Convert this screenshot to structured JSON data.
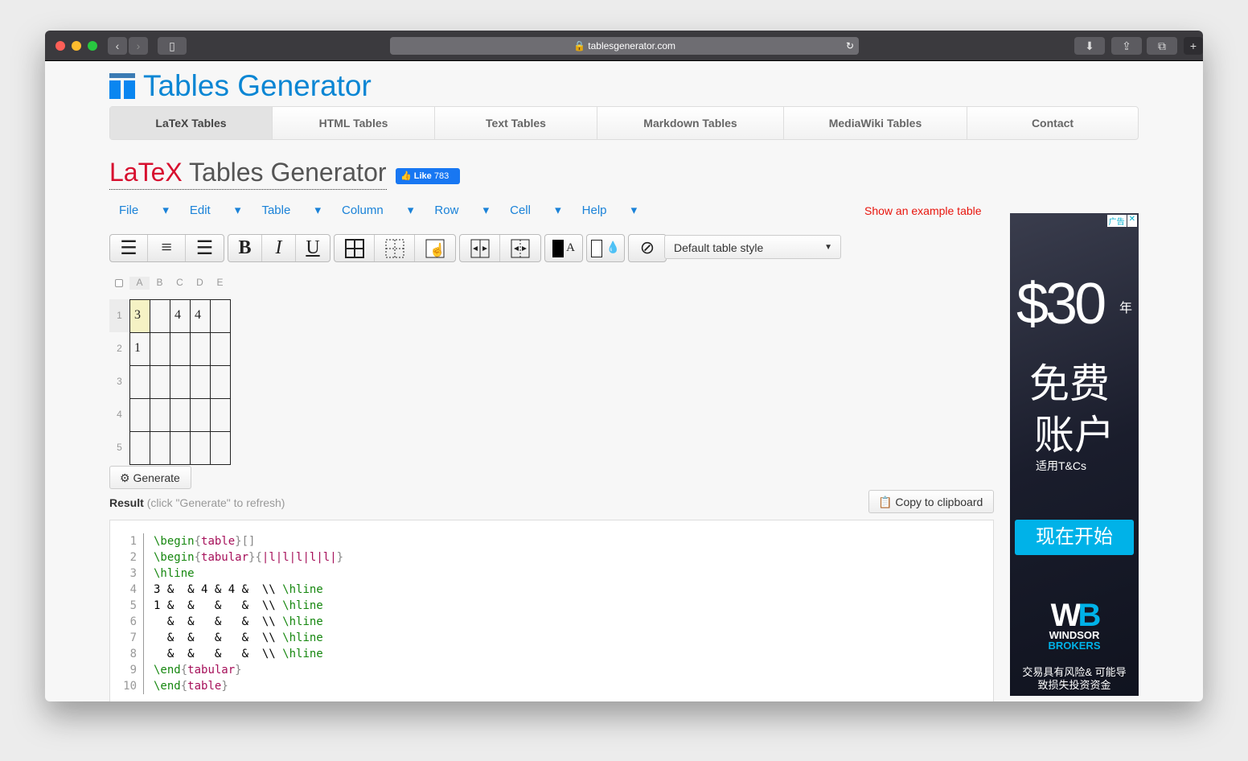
{
  "browser": {
    "url": "tablesgenerator.com"
  },
  "site": {
    "logo_text": "Tables Generator"
  },
  "nav": [
    {
      "label": "LaTeX Tables",
      "active": true
    },
    {
      "label": "HTML Tables"
    },
    {
      "label": "Text Tables"
    },
    {
      "label": "Markdown Tables"
    },
    {
      "label": "MediaWiki Tables"
    },
    {
      "label": "Contact"
    }
  ],
  "heading": {
    "latex": "LaTeX",
    "rest": " Tables Generator"
  },
  "like": {
    "label": "Like",
    "count": "783"
  },
  "menu": [
    "File",
    "Edit",
    "Table",
    "Column",
    "Row",
    "Cell",
    "Help"
  ],
  "example_link": "Show an example table",
  "table_style": "Default table style",
  "grid": {
    "columns": [
      "A",
      "B",
      "C",
      "D",
      "E"
    ],
    "rows": [
      "1",
      "2",
      "3",
      "4",
      "5"
    ],
    "cells": [
      [
        "3",
        "",
        "4",
        "4",
        ""
      ],
      [
        "1",
        "",
        "",
        "",
        ""
      ],
      [
        "",
        "",
        "",
        "",
        ""
      ],
      [
        "",
        "",
        "",
        "",
        ""
      ],
      [
        "",
        "",
        "",
        "",
        ""
      ]
    ],
    "selected": "A1"
  },
  "generate_label": "Generate",
  "result": {
    "label": "Result",
    "hint": "(click \"Generate\" to refresh)"
  },
  "copy_label": "Copy to clipboard",
  "code": {
    "line_numbers": [
      "1",
      "2",
      "3",
      "4",
      "5",
      "6",
      "7",
      "8",
      "9",
      "10"
    ],
    "lines": [
      "\\begin{table}[]",
      "\\begin{tabular}{|l|l|l|l|l|}",
      "\\hline",
      "3 &  & 4 & 4 &  \\\\ \\hline",
      "1 &  &   &   &  \\\\ \\hline",
      "  &  &   &   &  \\\\ \\hline",
      "  &  &   &   &  \\\\ \\hline",
      "  &  &   &   &  \\\\ \\hline",
      "\\end{tabular}",
      "\\end{table}"
    ]
  },
  "ad": {
    "badge": "广告",
    "price": "$30",
    "year": "年",
    "line1": "免费",
    "line2": "账户",
    "terms": "适用T&Cs",
    "cta": "现在开始",
    "brand1": "WINDSOR",
    "brand2": "BROKERS",
    "warning1": "交易具有风险& 可能导",
    "warning2": "致损失投资资金"
  },
  "colors": {
    "accent": "#0a86d4",
    "latex_red": "#d7102f",
    "link": "#1a82d8",
    "selected_cell": "#f5f2c4",
    "cta": "#00b2e8"
  }
}
